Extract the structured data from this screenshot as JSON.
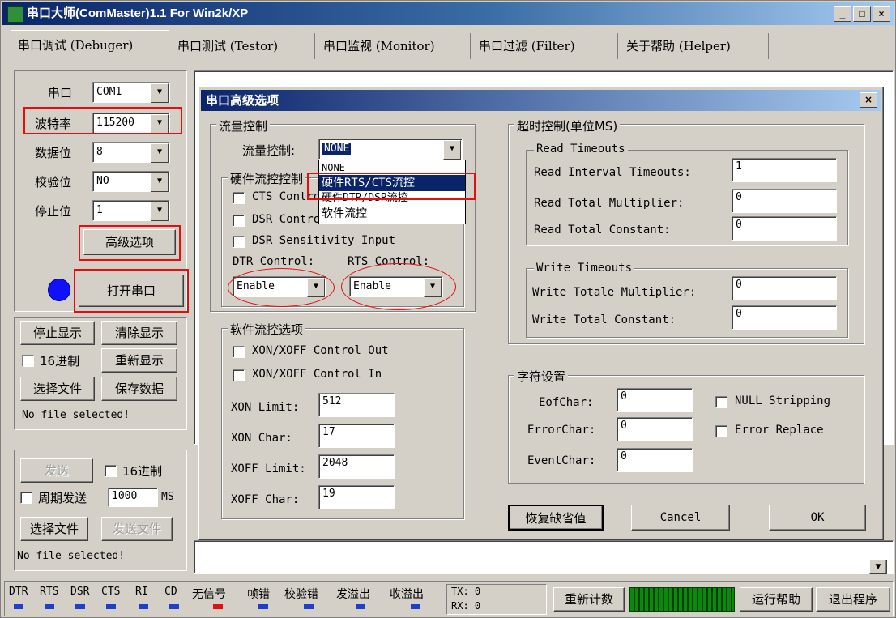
{
  "window": {
    "title": "串口大师(ComMaster)1.1 For Win2k/XP",
    "min_label": "_",
    "max_label": "□",
    "close_label": "×"
  },
  "tabs": [
    {
      "label": "串口调试 (Debuger)"
    },
    {
      "label": "串口测试 (Testor)"
    },
    {
      "label": "串口监视 (Monitor)"
    },
    {
      "label": "串口过滤 (Filter)"
    },
    {
      "label": "关于帮助 (Helper)"
    }
  ],
  "settings": {
    "port_label": "串口",
    "port_value": "COM1",
    "baud_label": "波特率",
    "baud_value": "115200",
    "databits_label": "数据位",
    "databits_value": "8",
    "parity_label": "校验位",
    "parity_value": "NO",
    "stopbits_label": "停止位",
    "stopbits_value": "1",
    "advanced_button": "高级选项",
    "open_button": "打开串口"
  },
  "receive": {
    "stop_display": "停止显示",
    "clear_display": "清除显示",
    "hex_label": "16进制",
    "redisplay": "重新显示",
    "choose_file": "选择文件",
    "save_data": "保存数据",
    "file_status": "No file selected!"
  },
  "send": {
    "send_button": "发送",
    "hex_label": "16进制",
    "periodic_label": "周期发送",
    "period_value": "1000",
    "period_unit": "MS",
    "choose_file": "选择文件",
    "send_file": "发送文件",
    "file_status": "No file selected!"
  },
  "statusbar": {
    "signals": [
      "DTR",
      "RTS",
      "DSR",
      "CTS",
      "RI",
      "CD"
    ],
    "errors": [
      "无信号",
      "帧错",
      "校验错",
      "发溢出",
      "收溢出"
    ],
    "tx_label": "TX: 0",
    "rx_label": "RX: 0",
    "recount_button": "重新计数",
    "help_button": "运行帮助",
    "exit_button": "退出程序"
  },
  "dialog": {
    "title": "串口高级选项",
    "close_label": "×",
    "flow": {
      "group_title": "流量控制",
      "flow_label": "流量控制:",
      "flow_value": "NONE",
      "dropdown_options": [
        "NONE",
        "硬件RTS/CTS流控",
        "硬件DTR/DSR流控",
        "软件流控"
      ],
      "hw_group_title": "硬件流控控制",
      "cts_label": "CTS Control",
      "dsr_label": "DSR Control",
      "dsr_sens_label": "DSR Sensitivity Input",
      "dtr_label": "DTR Control:",
      "rts_label": "RTS Control:",
      "dtr_value": "Enable",
      "rts_value": "Enable"
    },
    "soft": {
      "group_title": "软件流控选项",
      "xon_out": "XON/XOFF Control Out",
      "xon_in": "XON/XOFF Control In",
      "xon_limit_label": "XON Limit:",
      "xon_limit": "512",
      "xon_char_label": "XON Char:",
      "xon_char": "17",
      "xoff_limit_label": "XOFF Limit:",
      "xoff_limit": "2048",
      "xoff_char_label": "XOFF Char:",
      "xoff_char": "19"
    },
    "timeout": {
      "group_title": "超时控制(单位MS)",
      "read_title": "Read Timeouts",
      "read_interval_label": "Read Interval Timeouts:",
      "read_interval": "1",
      "read_mult_label": "Read Total Multiplier:",
      "read_mult": "0",
      "read_const_label": "Read Total Constant:",
      "read_const": "0",
      "write_title": "Write Timeouts",
      "write_mult_label": "Write Totale Multiplier:",
      "write_mult": "0",
      "write_const_label": "Write Total Constant:",
      "write_const": "0"
    },
    "chars": {
      "group_title": "字符设置",
      "eof_label": "EofChar:",
      "eof": "0",
      "error_label": "ErrorChar:",
      "error": "0",
      "event_label": "EventChar:",
      "event": "0",
      "null_strip": "NULL Stripping",
      "error_replace": "Error Replace"
    },
    "restore_button": "恢复缺省值",
    "cancel_button": "Cancel",
    "ok_button": "OK"
  }
}
